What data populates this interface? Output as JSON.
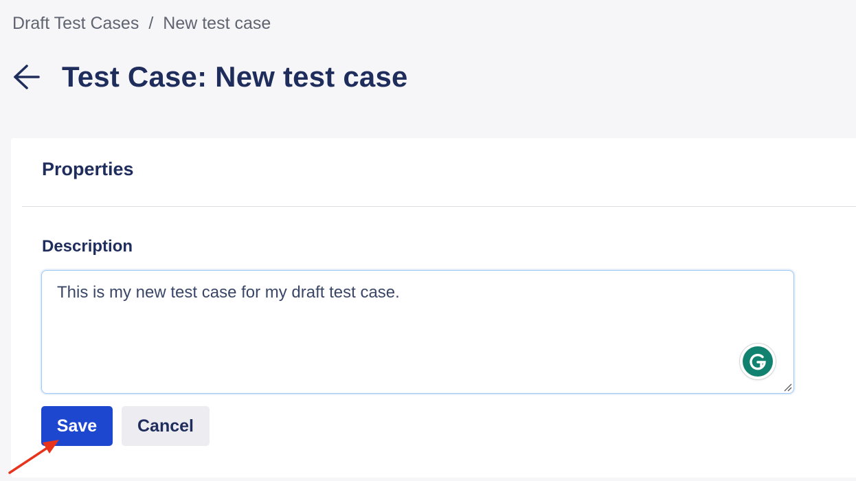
{
  "breadcrumb": {
    "parent": "Draft Test Cases",
    "separator": "/",
    "current": "New test case"
  },
  "header": {
    "back_icon": "arrow-left-icon",
    "title": "Test Case: New test case"
  },
  "card": {
    "section_title": "Properties",
    "description": {
      "label": "Description",
      "value": "This is my new test case for my draft test case.",
      "grammarly_icon": "grammarly-icon",
      "grammarly_letter": "G"
    },
    "actions": {
      "save_label": "Save",
      "cancel_label": "Cancel"
    }
  },
  "annotation": {
    "icon": "red-arrow-icon",
    "color": "#e8341c"
  },
  "colors": {
    "primary": "#1e47d0",
    "title": "#1f2d5c",
    "grammarly": "#11826f"
  }
}
